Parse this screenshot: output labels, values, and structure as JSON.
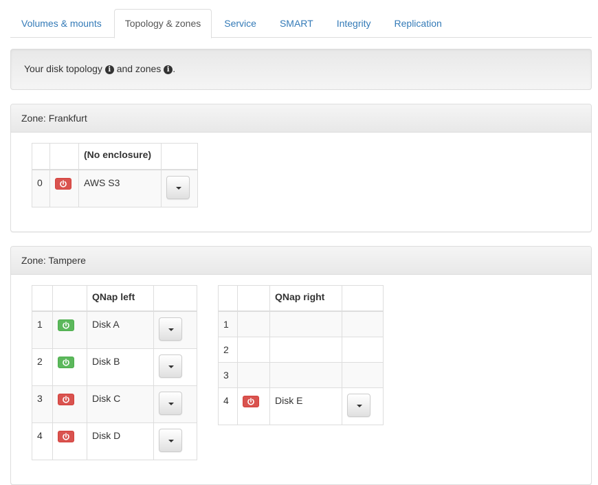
{
  "tabs": [
    {
      "label": "Volumes & mounts",
      "active": false
    },
    {
      "label": "Topology & zones",
      "active": true
    },
    {
      "label": "Service",
      "active": false
    },
    {
      "label": "SMART",
      "active": false
    },
    {
      "label": "Integrity",
      "active": false
    },
    {
      "label": "Replication",
      "active": false
    }
  ],
  "intro": {
    "text_before": "Your disk topology",
    "text_middle": "and zones",
    "text_after": ".",
    "info_glyph": "i"
  },
  "zones": [
    {
      "heading": "Zone: Frankfurt",
      "enclosures": [
        {
          "name": "(No enclosure)",
          "rows": [
            {
              "slot": "0",
              "status": "red",
              "disk": "AWS S3",
              "has_menu": true
            }
          ]
        }
      ]
    },
    {
      "heading": "Zone: Tampere",
      "enclosures": [
        {
          "name": "QNap left",
          "rows": [
            {
              "slot": "1",
              "status": "green",
              "disk": "Disk A",
              "has_menu": true
            },
            {
              "slot": "2",
              "status": "green",
              "disk": "Disk B",
              "has_menu": true
            },
            {
              "slot": "3",
              "status": "red",
              "disk": "Disk C",
              "has_menu": true
            },
            {
              "slot": "4",
              "status": "red",
              "disk": "Disk D",
              "has_menu": true
            }
          ]
        },
        {
          "name": "QNap right",
          "rows": [
            {
              "slot": "1",
              "status": "",
              "disk": "",
              "has_menu": false
            },
            {
              "slot": "2",
              "status": "",
              "disk": "",
              "has_menu": false
            },
            {
              "slot": "3",
              "status": "",
              "disk": "",
              "has_menu": false
            },
            {
              "slot": "4",
              "status": "red",
              "disk": "Disk E",
              "has_menu": true
            }
          ]
        }
      ]
    }
  ],
  "colors": {
    "red": "#d9534f",
    "green": "#5cb85c",
    "link": "#337ab7"
  }
}
